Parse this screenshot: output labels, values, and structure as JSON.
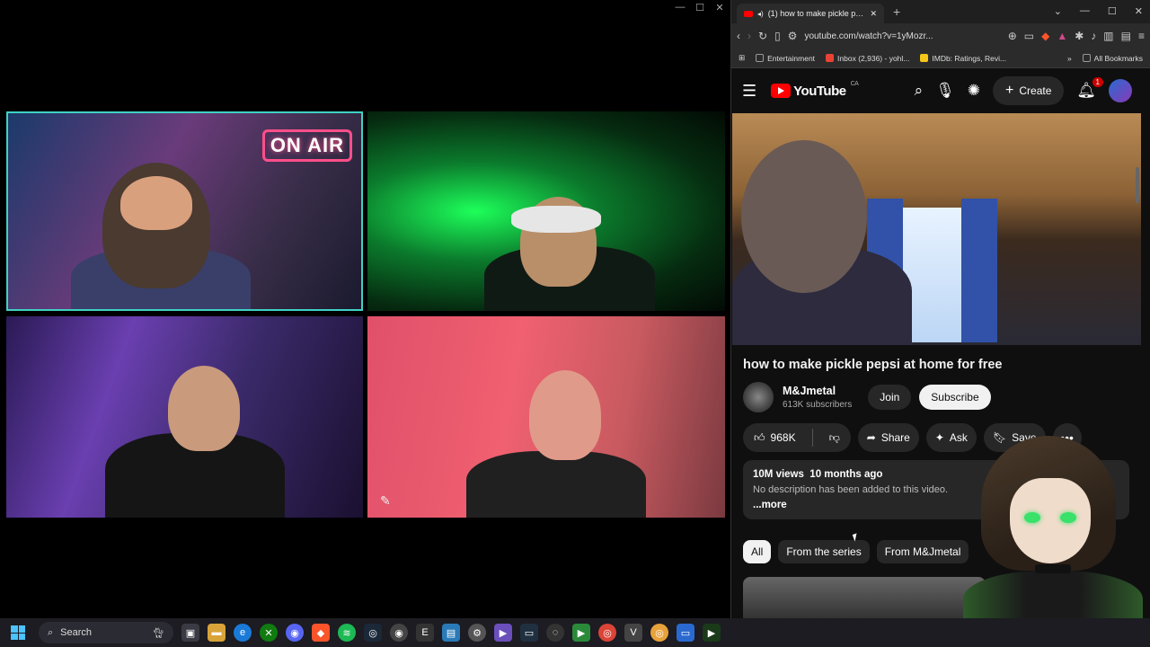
{
  "browser": {
    "tab_title": "(1) how to make pickle pepsi",
    "url": "youtube.com/watch?v=1yMozr...",
    "bookmarks": [
      {
        "label": "Entertainment",
        "color": "#999999"
      },
      {
        "label": "Inbox (2,936) - yohl...",
        "color": "#ea4335"
      },
      {
        "label": "IMDb: Ratings, Revi...",
        "color": "#f5c518"
      }
    ],
    "all_bookmarks": "All Bookmarks"
  },
  "youtube": {
    "logo_text": "YouTube",
    "region": "CA",
    "create_label": "Create",
    "notif_count": "1",
    "video_title": "how to make pickle pepsi at home for free",
    "channel": {
      "name": "M&Jmetal",
      "subs": "613K subscribers"
    },
    "join_label": "Join",
    "subscribe_label": "Subscribe",
    "likes": "968K",
    "share_label": "Share",
    "ask_label": "Ask",
    "save_label": "Save",
    "description": {
      "views": "10M views",
      "age": "10 months ago",
      "text": "No description has been added to this video.",
      "more": "...more"
    },
    "chips": [
      "All",
      "From the series",
      "From M&Jmetal"
    ]
  },
  "call": {
    "onair_sign": "ON AIR"
  },
  "taskbar": {
    "search_label": "Search"
  },
  "colors": {
    "accent_red": "#ff0000",
    "active_speaker_border": "#3fd1c4"
  }
}
